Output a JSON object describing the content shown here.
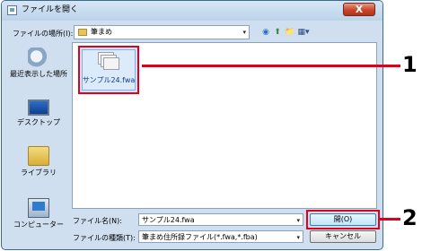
{
  "window": {
    "title": "ファイルを開く",
    "close_glyph": "X"
  },
  "toolbar": {
    "location_label": "ファイルの場所(I):",
    "location_value": "筆まめ",
    "arrow": "▾"
  },
  "toolbar_icons": [
    "◉",
    "⬆",
    "📁",
    "▦▾"
  ],
  "sidebar": {
    "items": [
      {
        "label": "最近表示した場所"
      },
      {
        "label": "デスクトップ"
      },
      {
        "label": "ライブラリ"
      },
      {
        "label": "コンピューター"
      }
    ]
  },
  "files": [
    {
      "name": "サンプル24.fwa"
    }
  ],
  "bottom": {
    "filename_label": "ファイル名(N):",
    "filename_value": "サンプル24.fwa",
    "filetype_label": "ファイルの種類(T):",
    "filetype_value": "筆まめ住所録ファイル(*.fwa,*.fba)",
    "open_button": "開(O)",
    "cancel_button": "キャンセル",
    "arrow": "▾"
  },
  "callouts": [
    "1",
    "2"
  ]
}
